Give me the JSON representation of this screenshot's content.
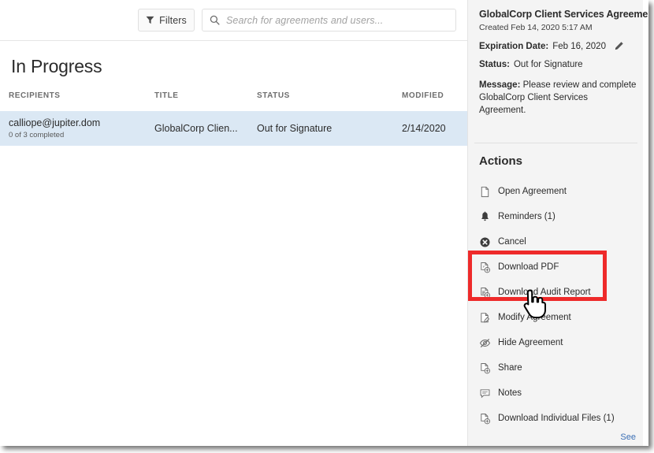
{
  "toolbar": {
    "filters_label": "Filters",
    "filters_icon": "funnel-icon",
    "search_placeholder": "Search for agreements and users...",
    "search_value": "",
    "search_icon": "search-icon"
  },
  "main": {
    "section_title": "In Progress",
    "columns": [
      "RECIPIENTS",
      "TITLE",
      "STATUS",
      "MODIFIED"
    ],
    "rows": [
      {
        "recipient": "calliope@jupiter.dom",
        "recipient_sub": "0 of 3 completed",
        "title": "GlobalCorp Clien...",
        "status": "Out for Signature",
        "modified": "2/14/2020",
        "selected": true
      }
    ]
  },
  "detail_panel": {
    "doc_title": "GlobalCorp Client Services Agreement",
    "created": "Created Feb 14, 2020 5:17 AM",
    "expiration_label": "Expiration Date:",
    "expiration_value": "Feb 16, 2020",
    "edit_icon": "pencil-icon",
    "status_label": "Status:",
    "status_value": "Out for Signature",
    "message_label": "Message:",
    "message_value": "Please review and complete GlobalCorp Client Services Agreement.",
    "actions_title": "Actions",
    "actions": [
      {
        "label": "Open Agreement",
        "icon": "document-icon"
      },
      {
        "label": "Reminders (1)",
        "icon": "bell-icon"
      },
      {
        "label": "Cancel",
        "icon": "cancel-circle-icon"
      },
      {
        "label": "Download PDF",
        "icon": "download-pdf-icon"
      },
      {
        "label": "Download Audit Report",
        "icon": "download-audit-icon"
      },
      {
        "label": "Modify Agreement",
        "icon": "edit-document-icon"
      },
      {
        "label": "Hide Agreement",
        "icon": "eye-slash-icon"
      },
      {
        "label": "Share",
        "icon": "share-document-icon"
      },
      {
        "label": "Notes",
        "icon": "note-icon"
      },
      {
        "label": "Download Individual Files (1)",
        "icon": "download-files-icon"
      }
    ],
    "see_more_label": "See"
  },
  "annotation": {
    "highlight_color": "#ee2a2a",
    "cursor_icon": "hand-pointer-cursor"
  },
  "colors": {
    "selected_row": "#dbe8f4",
    "panel_bg": "#f4f4f4",
    "link": "#3b6fb5",
    "highlight": "#ee2a2a"
  }
}
